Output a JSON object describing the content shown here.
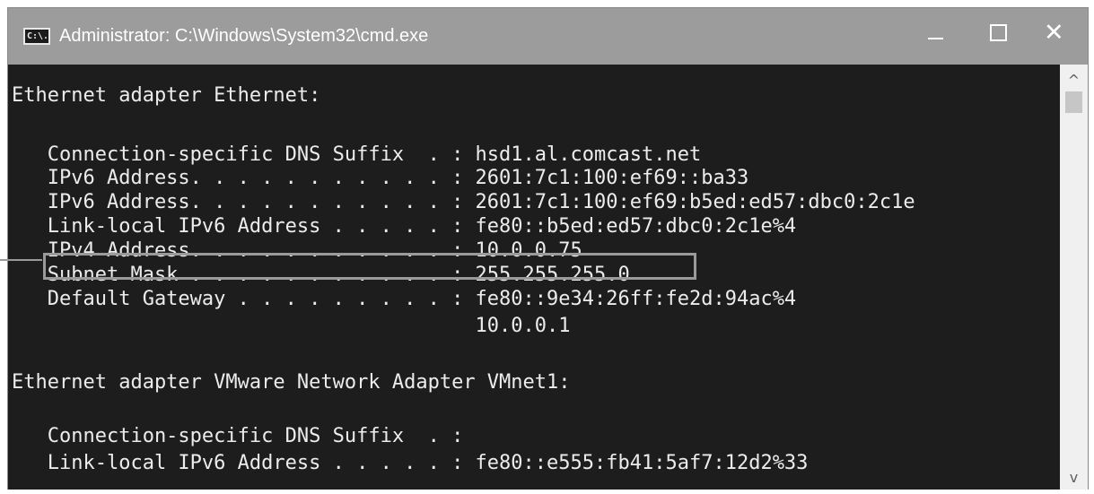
{
  "window": {
    "title": "Administrator: C:\\Windows\\System32\\cmd.exe",
    "icon_text": "C:\\.",
    "icons": {
      "app": "command-prompt-icon",
      "minimize": "minimize-icon",
      "maximize": "maximize-icon",
      "close": "close-icon",
      "close_glyph": "✕",
      "scroll_up": "chevron-up-icon",
      "scroll_up_glyph": "^",
      "scroll_down": "chevron-down-icon",
      "scroll_down_glyph": "v"
    }
  },
  "console": {
    "lines": [
      "Ethernet adapter Ethernet:",
      "",
      "   Connection-specific DNS Suffix  . : hsd1.al.comcast.net",
      "   IPv6 Address. . . . . . . . . . . : 2601:7c1:100:ef69::ba33",
      "   IPv6 Address. . . . . . . . . . . : 2601:7c1:100:ef69:b5ed:ed57:dbc0:2c1e",
      "   Link-local IPv6 Address . . . . . : fe80::b5ed:ed57:dbc0:2c1e%4",
      "   IPv4 Address. . . . . . . . . . . : 10.0.0.75",
      "   Subnet Mask . . . . . . . . . . . : 255.255.255.0",
      "   Default Gateway . . . . . . . . . : fe80::9e34:26ff:fe2d:94ac%4",
      "                                       10.0.0.1",
      "",
      "Ethernet adapter VMware Network Adapter VMnet1:",
      "",
      "   Connection-specific DNS Suffix  . :",
      "   Link-local IPv6 Address . . . . . : fe80::e555:fb41:5af7:12d2%33"
    ]
  },
  "colors": {
    "console_bg": "#1d1d1d",
    "console_text": "#ececec",
    "titlebar_bg": "#9c9c9c",
    "highlight_border": "#9a9a9a"
  }
}
